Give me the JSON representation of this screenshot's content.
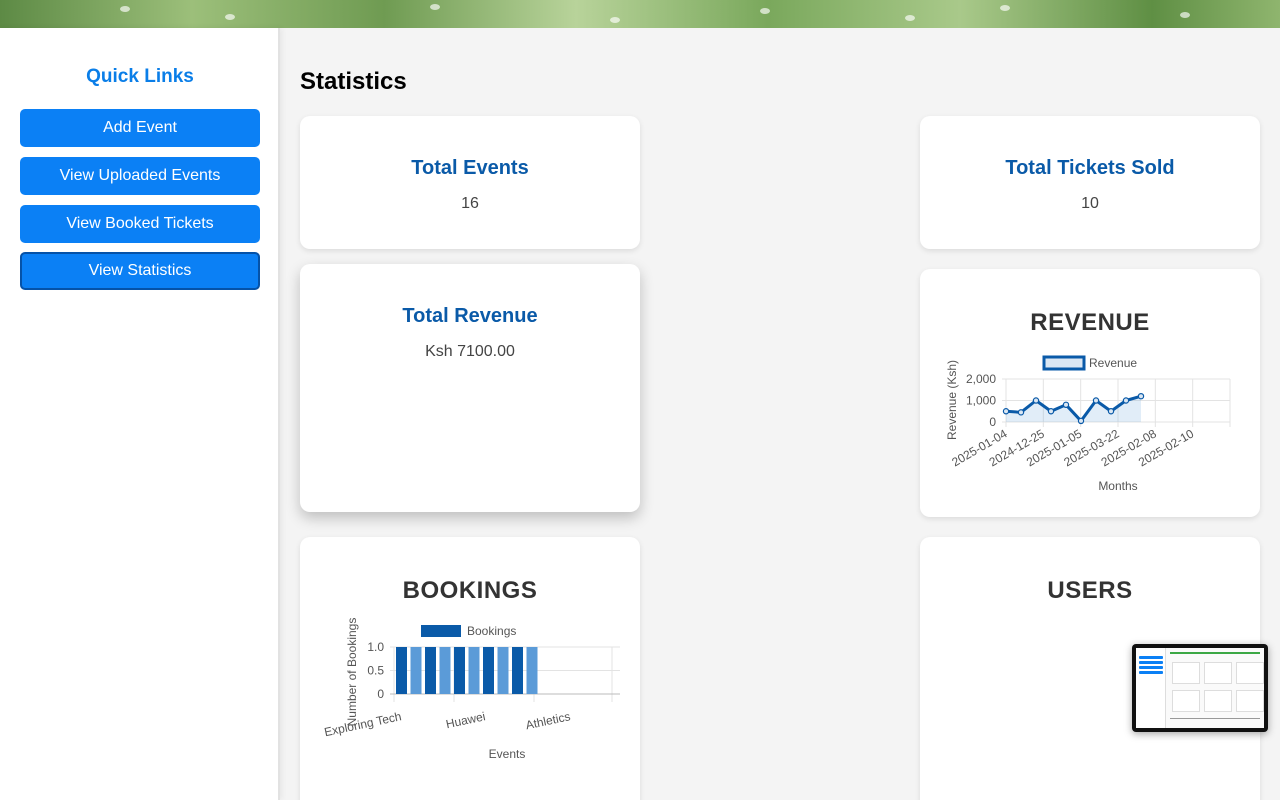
{
  "sidebar": {
    "heading": "Quick Links",
    "buttons": [
      {
        "label": "Add Event"
      },
      {
        "label": "View Uploaded Events"
      },
      {
        "label": "View Booked Tickets"
      },
      {
        "label": "View Statistics",
        "active": true
      }
    ]
  },
  "main": {
    "title": "Statistics",
    "stats": {
      "total_events": {
        "label": "Total Events",
        "value": "16"
      },
      "total_tickets": {
        "label": "Total Tickets Sold",
        "value": "10"
      },
      "total_revenue": {
        "label": "Total Revenue",
        "value": "Ksh 7100.00"
      }
    },
    "charts": {
      "revenue_title": "REVENUE",
      "bookings_title": "BOOKINGS",
      "users_title": "USERS"
    }
  },
  "colors": {
    "accent": "#0b80f5",
    "stat_title": "#0a5aa8",
    "series_dark": "#0a5aa8",
    "series_light": "#5b9bd8"
  },
  "chart_data": [
    {
      "type": "line",
      "title": "REVENUE",
      "legend": [
        "Revenue"
      ],
      "legend_position": "top",
      "xlabel": "Months",
      "ylabel": "Revenue (Ksh)",
      "x": [
        "2025-01-04",
        "2024-12-25",
        "2025-01-05",
        "2025-03-22",
        "2025-02-08",
        "2025-02-10"
      ],
      "y_ticks": [
        "2,000",
        "1,000",
        "0"
      ],
      "ylim": [
        0,
        2000
      ],
      "series": [
        {
          "name": "Revenue",
          "values": [
            500,
            450,
            1000,
            500,
            800,
            50,
            1000,
            500,
            1000,
            1200
          ]
        }
      ],
      "grid": true
    },
    {
      "type": "bar",
      "title": "BOOKINGS",
      "legend": [
        "Bookings"
      ],
      "legend_position": "top",
      "xlabel": "Events",
      "ylabel": "Number of Bookings",
      "tick_labels": [
        "Exploring Tech",
        "Huawei",
        "Athletics"
      ],
      "y_ticks": [
        "1.0",
        "0.5",
        "0"
      ],
      "ylim": [
        0,
        1
      ],
      "series": [
        {
          "name": "Bookings",
          "values": [
            1,
            1,
            1,
            1,
            1,
            1,
            1,
            1,
            1,
            1
          ]
        }
      ],
      "grid": true
    }
  ]
}
